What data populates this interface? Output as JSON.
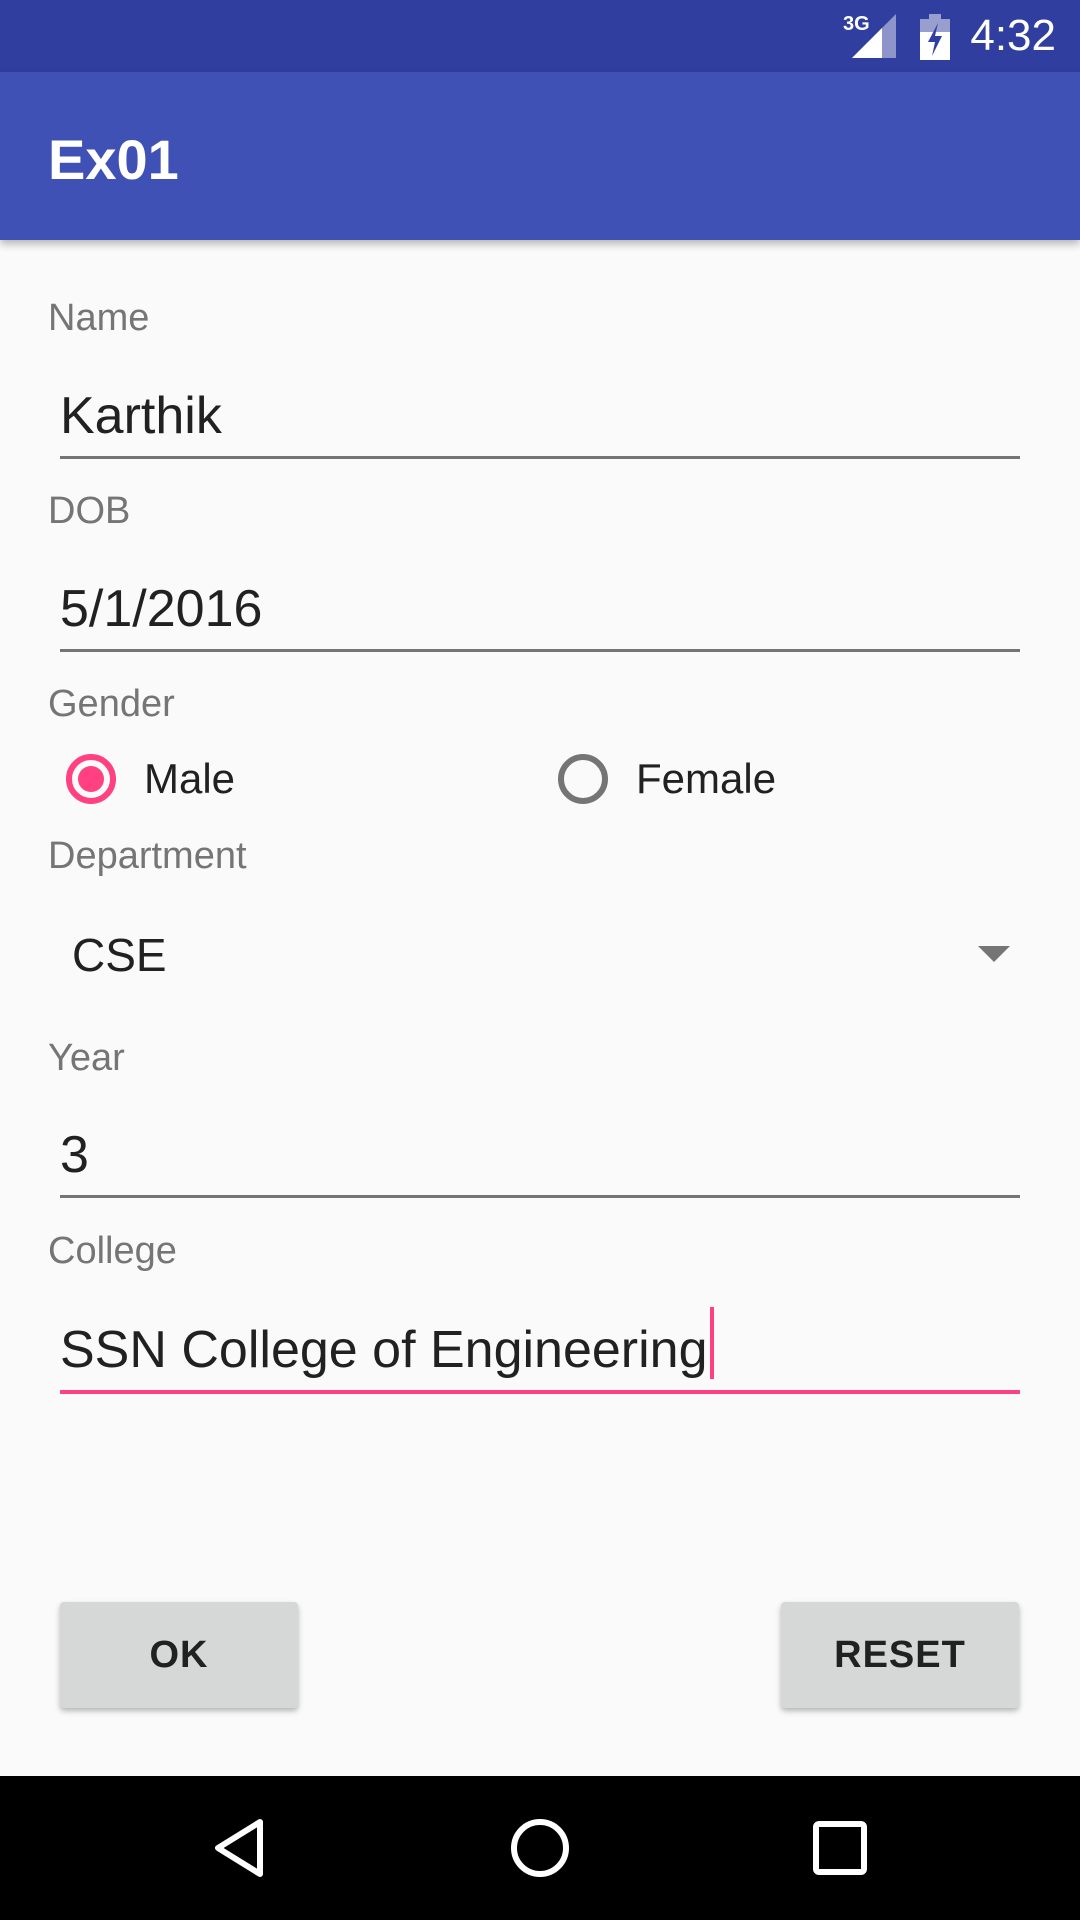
{
  "status_bar": {
    "network_label": "3G",
    "time": "4:32",
    "signal_icon": "signal-icon",
    "battery_icon": "battery-charging-icon"
  },
  "app_bar": {
    "title": "Ex01"
  },
  "form": {
    "name": {
      "label": "Name",
      "value": "Karthik"
    },
    "dob": {
      "label": "DOB",
      "value": "5/1/2016"
    },
    "gender": {
      "label": "Gender",
      "options": [
        {
          "label": "Male",
          "checked": true
        },
        {
          "label": "Female",
          "checked": false
        }
      ]
    },
    "department": {
      "label": "Department",
      "value": "CSE"
    },
    "year": {
      "label": "Year",
      "value": "3"
    },
    "college": {
      "label": "College",
      "value": "SSN College of Engineering"
    }
  },
  "buttons": {
    "ok": "OK",
    "reset": "RESET"
  },
  "nav_bar": {
    "icons": [
      "back-icon",
      "home-icon",
      "recents-icon"
    ]
  },
  "colors": {
    "status_bar": "#303f9f",
    "primary": "#3f51b5",
    "accent": "#ff4081",
    "background": "#fafafa",
    "button": "#d6d7d7"
  }
}
